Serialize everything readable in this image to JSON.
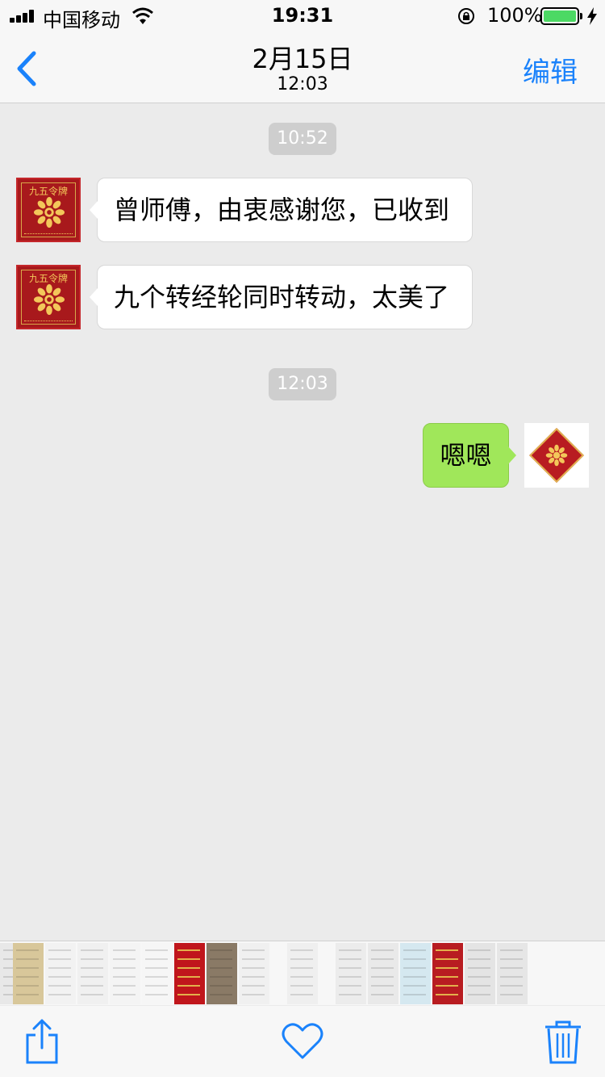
{
  "status_bar": {
    "carrier": "中国移动",
    "time": "19:31",
    "battery": "100%"
  },
  "nav": {
    "title": "2月15日",
    "subtitle": "12:03",
    "edit_label": "编辑"
  },
  "chat": {
    "timestamps": [
      "10:52",
      "12:03"
    ],
    "avatar_text": "九五令牌",
    "messages": [
      {
        "from": "other",
        "text": "曾师傅，由衷感谢您，已收到"
      },
      {
        "from": "other",
        "text": "九个转经轮同时转动，太美了"
      },
      {
        "from": "self",
        "text": "嗯嗯"
      }
    ]
  },
  "thumbnails": {
    "count": 16,
    "colors": [
      "#e8e8e8",
      "#d8c79a",
      "#f2f2f2",
      "#f0f0f0",
      "#f4f4f4",
      "#f6f6f6",
      "#c0161c",
      "#8a7a66",
      "#f0f0f0",
      "#efefef",
      "#ececec",
      "#e9e9e9",
      "#d5e8f0",
      "#b81c21",
      "#e4e4e4",
      "#e6e6e6",
      "#6e4a3e"
    ]
  },
  "toolbar": {
    "icons": [
      "share-icon",
      "heart-icon",
      "trash-icon"
    ]
  },
  "colors": {
    "accent": "#1a82fb",
    "outgoing_bubble": "#a0e75a",
    "background": "#ebebeb"
  }
}
